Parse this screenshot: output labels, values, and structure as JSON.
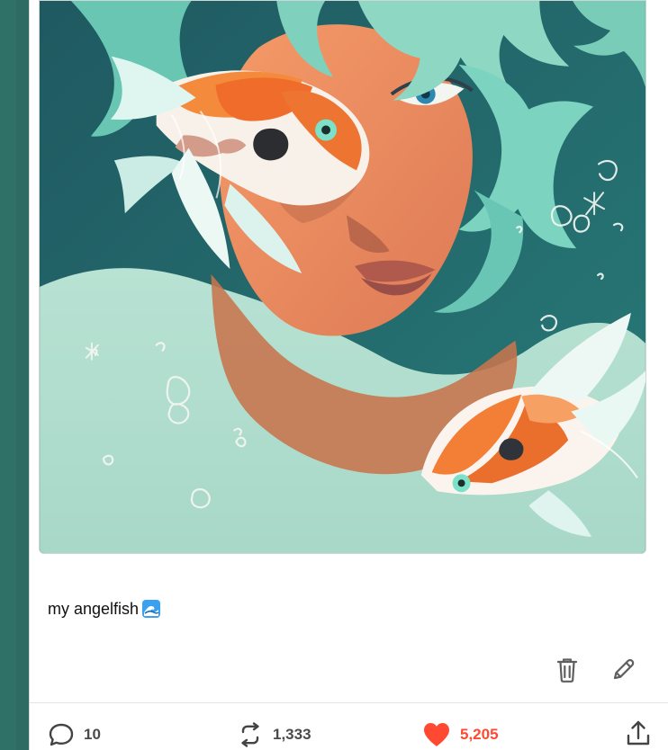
{
  "post": {
    "caption": "my angelfish",
    "caption_emoji_icon": "water-wave-icon"
  },
  "actions": {
    "delete_icon": "trash-icon",
    "edit_icon": "pencil-icon"
  },
  "footer": {
    "comments_count": "10",
    "reblogs_count": "1,333",
    "likes_count": "5,205",
    "comments_icon": "comment-bubble-icon",
    "reblogs_icon": "repost-arrows-icon",
    "likes_icon": "heart-icon",
    "share_icon": "share-upload-icon"
  },
  "colors": {
    "accent_like": "#ff4930",
    "background_teal": "#2e6b63",
    "card_white": "#ffffff"
  }
}
